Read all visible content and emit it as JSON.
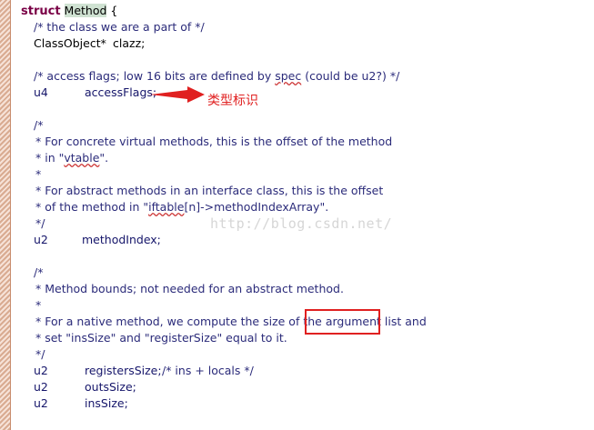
{
  "code": {
    "l1": {
      "kw": "struct",
      "name": "Method",
      "brace": " {"
    },
    "l2": "/* the class we are a part of */",
    "l3": {
      "type": "ClassObject*",
      "ident": "clazz;"
    },
    "l4": {
      "pre": "/* access flags; low 16 bits are defined by ",
      "squig": "spec",
      "post": " (could be u2?) */"
    },
    "l5": {
      "type": "u4",
      "ident": "accessFlags;"
    },
    "l6": "/*",
    "l7": "* For concrete virtual methods, this is the offset of the method",
    "l8": {
      "pre": "* in \"",
      "squig": "vtable",
      "post": "\"."
    },
    "l9": "*",
    "l10": "* For abstract methods in an interface class, this is the offset",
    "l11": {
      "pre": "* of the method in \"",
      "squig": "iftable",
      "post": "[n]->methodIndexArray\"."
    },
    "l12": "*/",
    "l13": {
      "type": "u2",
      "ident": "methodIndex;"
    },
    "l14": "/*",
    "l15": "* Method bounds; not needed for an abstract method.",
    "l16": "*",
    "l17": {
      "pre": "* For a native method, we compute the size of the ",
      "box": "argument list",
      "post": " and"
    },
    "l18": "* set \"insSize\" and \"registerSize\" equal to it.",
    "l19": "*/",
    "l20": {
      "type": "u2",
      "ident": "registersSize;",
      "comment": "/* ins + locals */"
    },
    "l21": {
      "type": "u2",
      "ident": "outsSize;"
    },
    "l22": {
      "type": "u2",
      "ident": "insSize;"
    }
  },
  "annotation": {
    "label": "类型标识",
    "color": "#e02020"
  },
  "watermark": "http://blog.csdn.net/"
}
